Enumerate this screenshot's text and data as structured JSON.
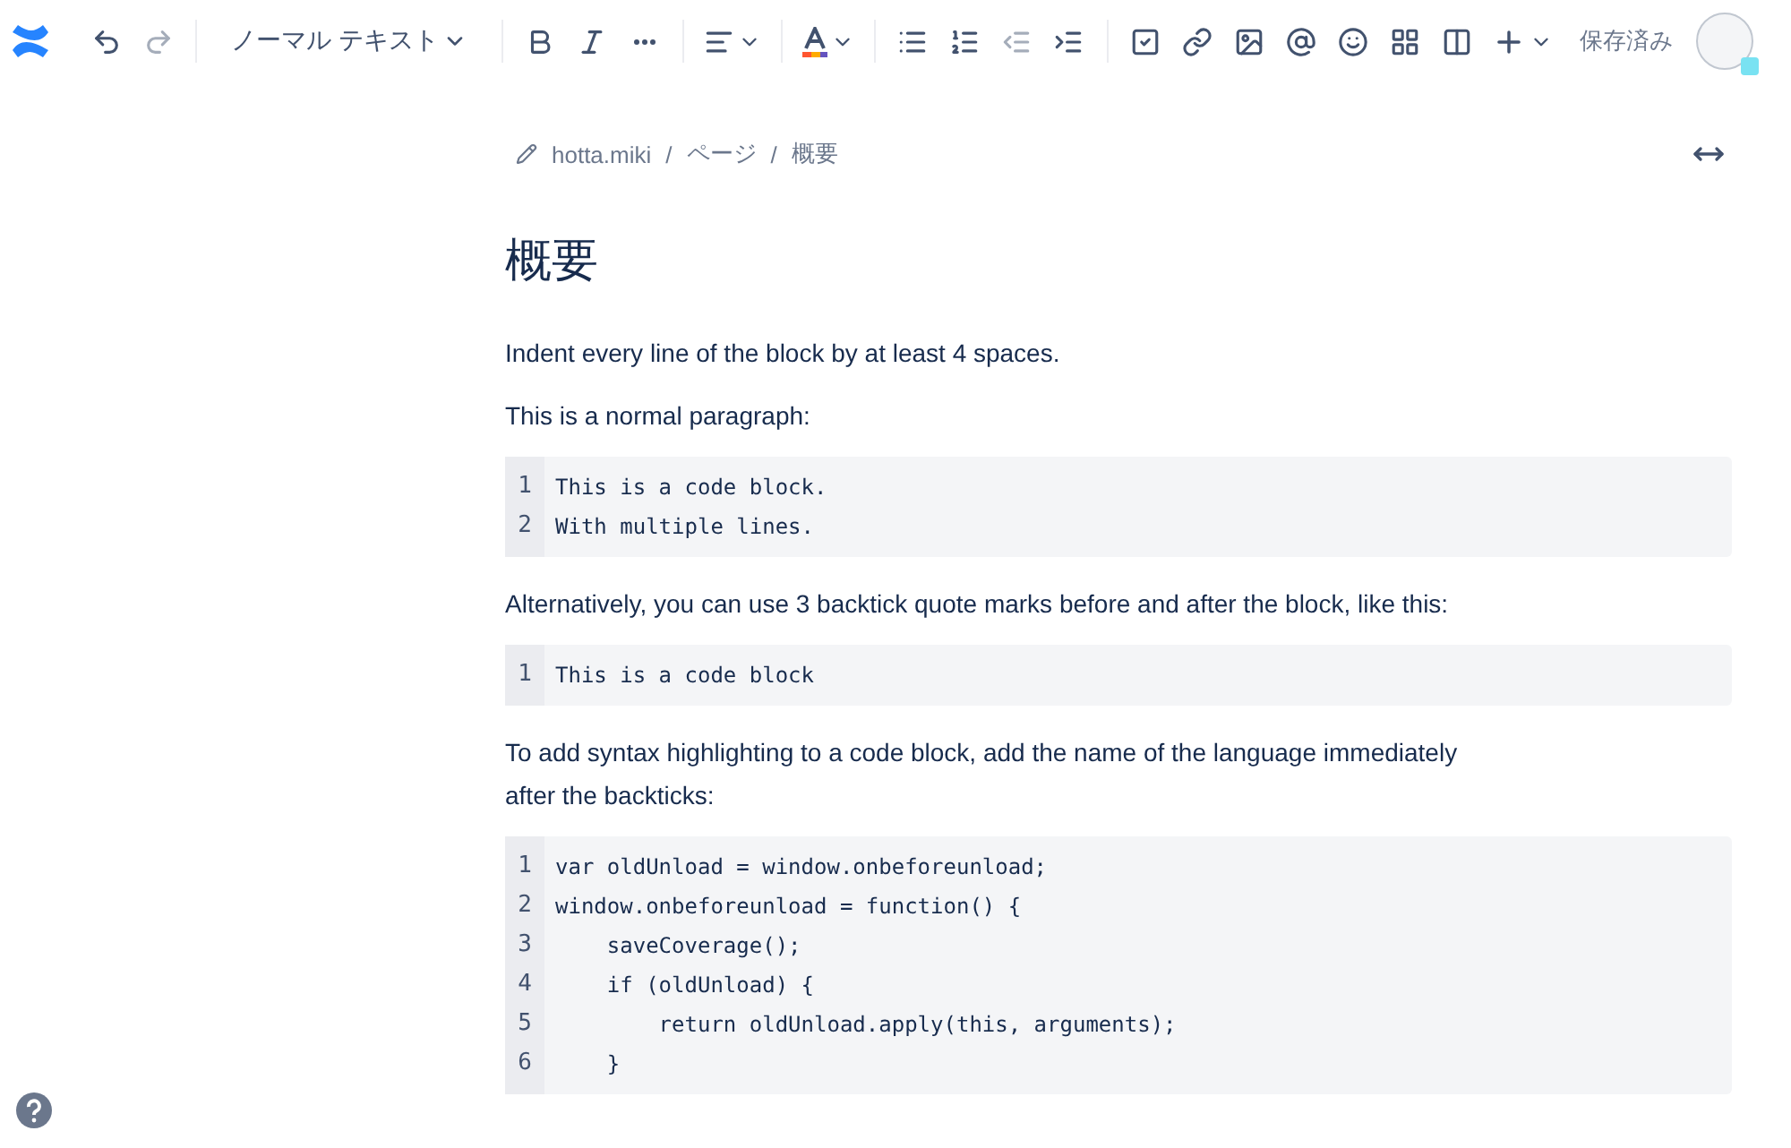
{
  "toolbar": {
    "history": [
      {
        "disabled": false
      },
      {
        "disabled": true
      }
    ],
    "text_style": "ノーマル テキスト",
    "lists": [
      {
        "disabled": false
      },
      {
        "disabled": false
      },
      {
        "disabled": true
      },
      {
        "disabled": false
      }
    ],
    "status": "保存済み"
  },
  "breadcrumb": [
    "hotta.miki",
    "ページ",
    "概要"
  ],
  "separator": "/",
  "title": "概要",
  "blocks": [
    {
      "kind": "paragraph",
      "text": "Indent every line of the block by at least 4 spaces."
    },
    {
      "kind": "paragraph",
      "text": "This is a normal paragraph:"
    },
    {
      "kind": "code",
      "lines": [
        {
          "number": "1",
          "text": "This is a code block."
        },
        {
          "number": "2",
          "text": "With multiple lines."
        }
      ]
    },
    {
      "kind": "paragraph",
      "text": "Alternatively, you can use 3 backtick quote marks before and after the block, like this:"
    },
    {
      "kind": "code",
      "lines": [
        {
          "number": "1",
          "text": "This is a code block"
        }
      ]
    },
    {
      "kind": "paragraph",
      "text": "To add syntax highlighting to a code block, add the name of the language immediately after the backticks:"
    },
    {
      "kind": "code",
      "lines": [
        {
          "number": "1",
          "text": "var oldUnload = window.onbeforeunload;"
        },
        {
          "number": "2",
          "text": "window.onbeforeunload = function() {"
        },
        {
          "number": "3",
          "text": "    saveCoverage();"
        },
        {
          "number": "4",
          "text": "    if (oldUnload) {"
        },
        {
          "number": "5",
          "text": "        return oldUnload.apply(this, arguments);"
        },
        {
          "number": "6",
          "text": "    }"
        }
      ]
    }
  ]
}
